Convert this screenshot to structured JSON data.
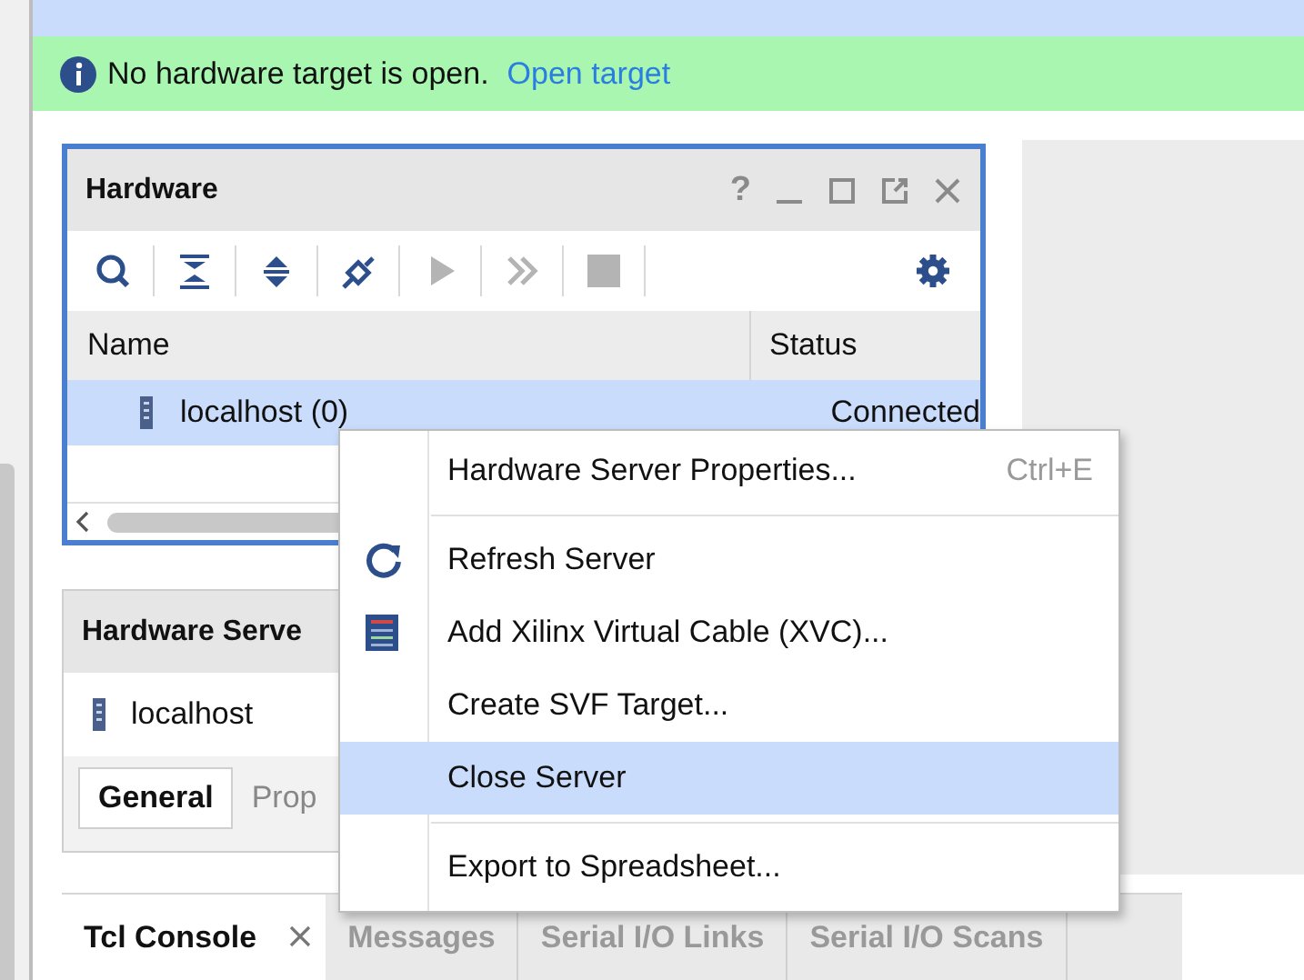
{
  "banner": {
    "message": "No hardware target is open.",
    "link": "Open target"
  },
  "hardware_panel": {
    "title": "Hardware",
    "help": "?",
    "tools": [
      {
        "kind": "search",
        "disabled": false
      },
      {
        "kind": "collapse",
        "disabled": false
      },
      {
        "kind": "expand",
        "disabled": false
      },
      {
        "kind": "connect",
        "disabled": false
      },
      {
        "kind": "run",
        "disabled": true
      },
      {
        "kind": "forward",
        "disabled": true
      },
      {
        "kind": "stop",
        "disabled": true
      },
      {
        "kind": "settings",
        "disabled": false
      }
    ],
    "columns": [
      "Name",
      "Status"
    ],
    "rows": [
      {
        "name": "localhost (0)",
        "status": "Connected",
        "selected": true
      }
    ]
  },
  "hardware_server_panel": {
    "title": "Hardware Serve",
    "item": "localhost",
    "tabs": [
      {
        "label": "General",
        "selected": true
      },
      {
        "label": "Prop",
        "selected": false
      }
    ]
  },
  "bottom_tabs": [
    {
      "label": "Tcl Console",
      "selected": true,
      "closable": true
    },
    {
      "label": "Messages",
      "selected": false,
      "closable": false
    },
    {
      "label": "Serial I/O Links",
      "selected": false,
      "closable": false
    },
    {
      "label": "Serial I/O Scans",
      "selected": false,
      "closable": false
    }
  ],
  "context_menu": [
    {
      "label": "Hardware Server Properties...",
      "shortcut": "Ctrl+E",
      "kind": "plain",
      "selected": false,
      "separator_after": true
    },
    {
      "label": "Refresh Server",
      "kind": "refresh",
      "selected": false,
      "separator_after": false
    },
    {
      "label": "Add Xilinx Virtual Cable (XVC)...",
      "kind": "cable",
      "selected": false,
      "separator_after": false
    },
    {
      "label": "Create SVF Target...",
      "kind": "plain",
      "selected": false,
      "separator_after": false
    },
    {
      "label": "Close Server",
      "kind": "plain",
      "selected": true,
      "separator_after": true
    },
    {
      "label": "Export to Spreadsheet...",
      "kind": "plain",
      "selected": false,
      "separator_after": false
    }
  ]
}
